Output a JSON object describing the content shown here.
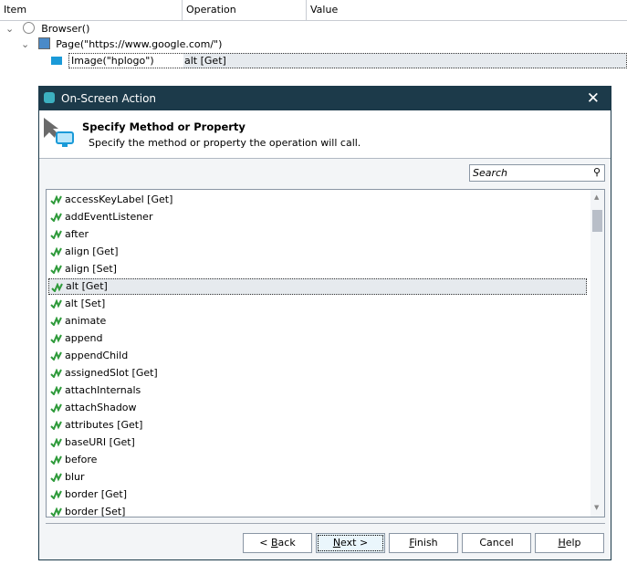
{
  "columns": [
    "Item",
    "Operation",
    "Value"
  ],
  "tree": [
    {
      "label": "Browser()",
      "icon": "globe-icon",
      "operation": ""
    },
    {
      "label": "Page(\"https://www.google.com/\")",
      "icon": "web-page-icon",
      "operation": ""
    },
    {
      "label": "Image(\"hplogo\")",
      "icon": "onscreen-object-icon",
      "operation": "alt [Get]"
    }
  ],
  "dialog": {
    "title": "On-Screen Action",
    "heading": "Specify Method or Property",
    "subheading": "Specify the method or property the operation will call.",
    "search_placeholder": "Search",
    "items": [
      "accessKeyLabel [Get]",
      "addEventListener",
      "after",
      "align [Get]",
      "align [Set]",
      "alt [Get]",
      "alt [Set]",
      "animate",
      "append",
      "appendChild",
      "assignedSlot [Get]",
      "attachInternals",
      "attachShadow",
      "attributes [Get]",
      "baseURI [Get]",
      "before",
      "blur",
      "border [Get]",
      "border [Set]"
    ],
    "selected_index": 5,
    "buttons": {
      "back": "ack",
      "back_prefix": "< ",
      "back_key": "B",
      "next_key": "N",
      "next": "ext >",
      "finish_key": "F",
      "finish": "inish",
      "cancel": "Cancel",
      "help_key": "H",
      "help": "elp"
    }
  },
  "colors": {
    "titlebar": "#1c3a4a",
    "method_icon": "#2e9a3a"
  }
}
